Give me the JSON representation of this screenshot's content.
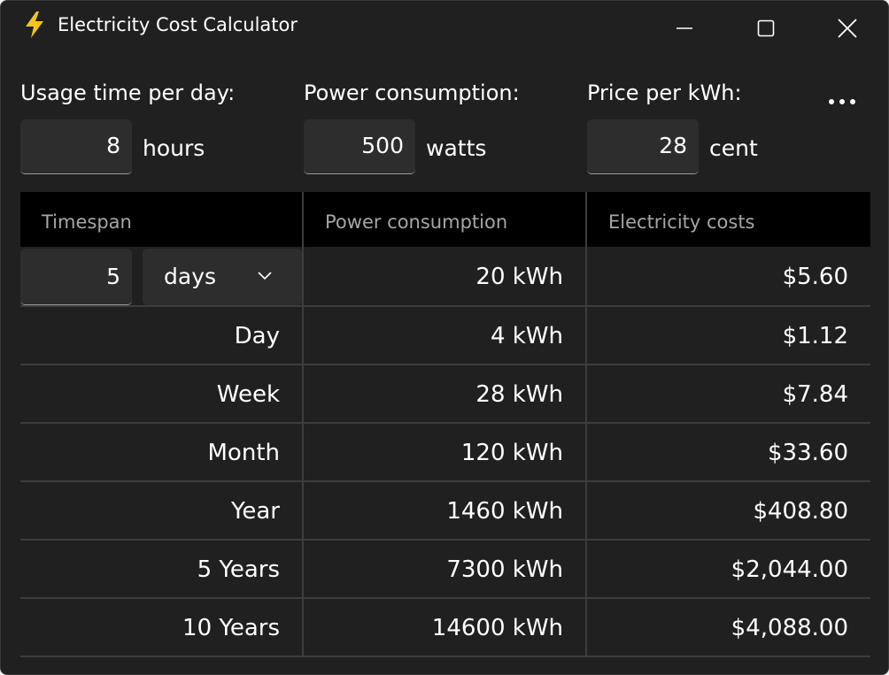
{
  "window": {
    "title": "Electricity Cost Calculator",
    "icon": "lightning-bolt-icon",
    "accent_color": "#f5c518",
    "background": "#202020"
  },
  "inputs": {
    "usage": {
      "label": "Usage time per day:",
      "value": "8",
      "unit": "hours"
    },
    "power": {
      "label": "Power consumption:",
      "value": "500",
      "unit": "watts"
    },
    "price": {
      "label": "Price per kWh:",
      "value": "28",
      "unit": "cent"
    }
  },
  "table": {
    "headers": [
      "Timespan",
      "Power consumption",
      "Electricity costs"
    ],
    "custom": {
      "count": "5",
      "unit_selected": "days",
      "power": "20 kWh",
      "cost": "$5.60"
    },
    "rows": [
      {
        "timespan": "Day",
        "power": "4 kWh",
        "cost": "$1.12"
      },
      {
        "timespan": "Week",
        "power": "28 kWh",
        "cost": "$7.84"
      },
      {
        "timespan": "Month",
        "power": "120 kWh",
        "cost": "$33.60"
      },
      {
        "timespan": "Year",
        "power": "1460 kWh",
        "cost": "$408.80"
      },
      {
        "timespan": "5 Years",
        "power": "7300 kWh",
        "cost": "$2,044.00"
      },
      {
        "timespan": "10 Years",
        "power": "14600 kWh",
        "cost": "$4,088.00"
      }
    ]
  }
}
